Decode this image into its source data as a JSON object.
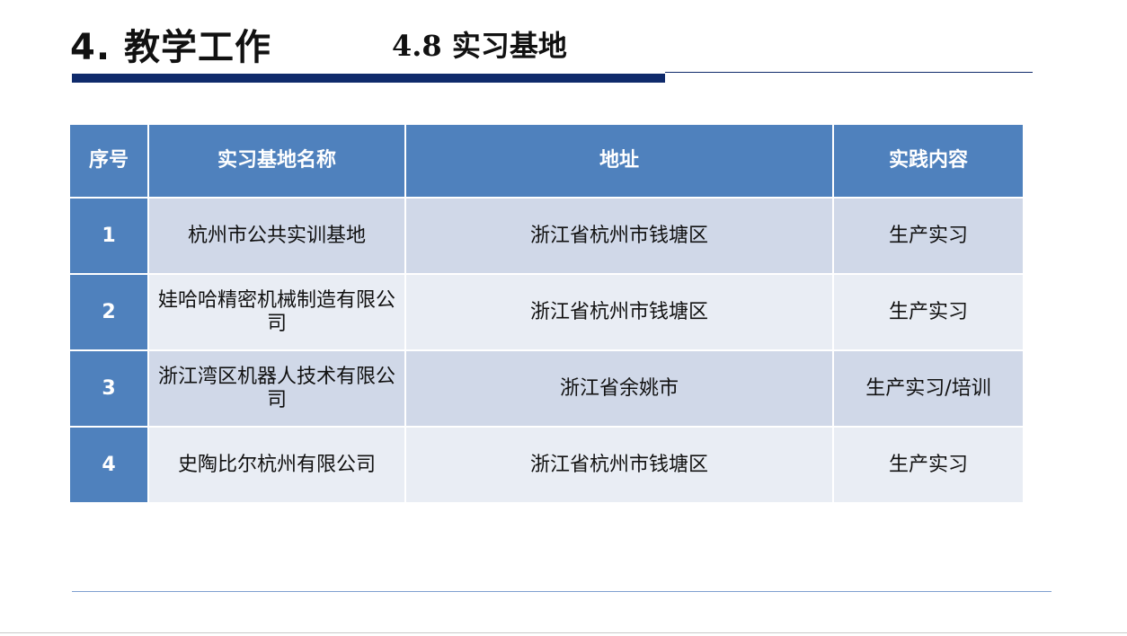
{
  "header": {
    "main_title": "4. 教学工作",
    "sub_title": "4.8 实习基地"
  },
  "table": {
    "columns": [
      "序号",
      "实习基地名称",
      "地址",
      "实践内容"
    ],
    "rows": [
      {
        "index": "1",
        "name": "杭州市公共实训基地",
        "address": "浙江省杭州市钱塘区",
        "content": "生产实习"
      },
      {
        "index": "2",
        "name": "娃哈哈精密机械制造有限公司",
        "address": "浙江省杭州市钱塘区",
        "content": "生产实习"
      },
      {
        "index": "3",
        "name": "浙江湾区机器人技术有限公司",
        "address": "浙江省余姚市",
        "content": "生产实习/培训"
      },
      {
        "index": "4",
        "name": "史陶比尔杭州有限公司",
        "address": "浙江省杭州市钱塘区",
        "content": "生产实习"
      }
    ]
  },
  "colors": {
    "header_fill": "#4f81bd",
    "row_odd": "#d0d8e8",
    "row_even": "#e9edf4",
    "rule": "#0f2a6b"
  }
}
